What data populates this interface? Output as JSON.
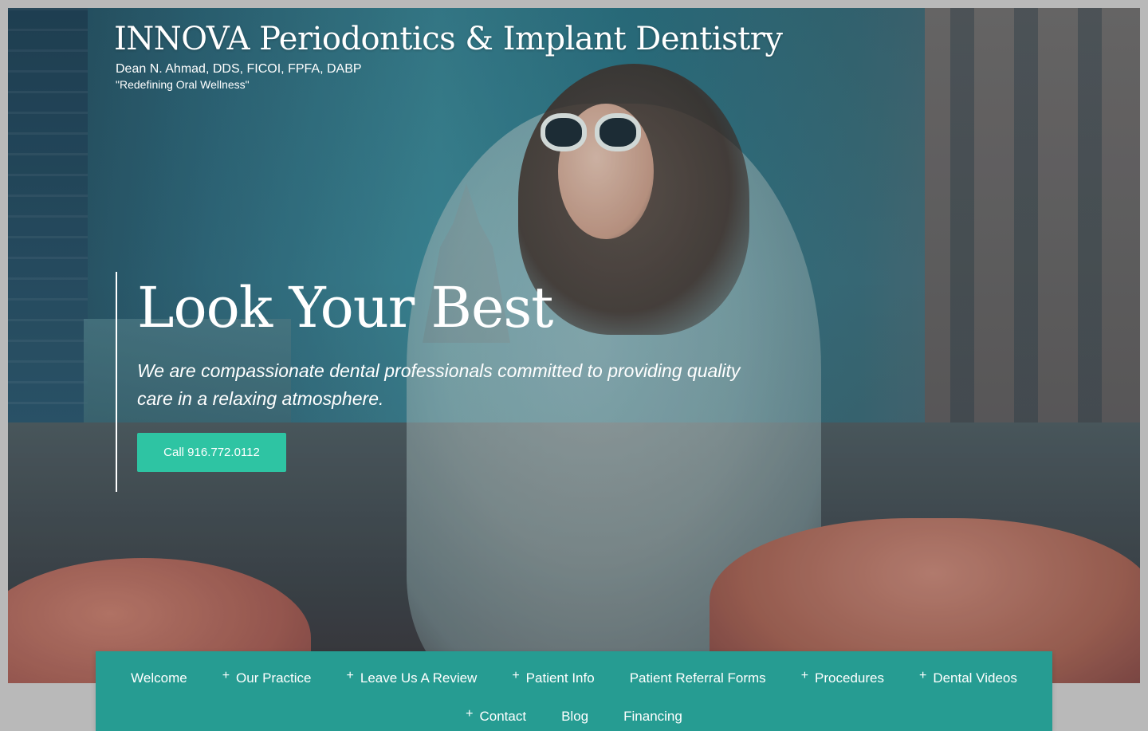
{
  "header": {
    "site_title": "INNOVA Periodontics & Implant Dentistry",
    "doctor": "Dean N. Ahmad, DDS, FICOI, FPFA, DABP",
    "tagline": "\"Redefining Oral Wellness\""
  },
  "hero": {
    "heading": "Look Your Best",
    "subheading": "We are compassionate dental professionals committed to providing quality care in a relaxing atmosphere.",
    "cta_label": "Call 916.772.0112"
  },
  "nav": {
    "items": [
      {
        "label": "Welcome",
        "has_submenu": false
      },
      {
        "label": "Our Practice",
        "has_submenu": true
      },
      {
        "label": "Leave Us A Review",
        "has_submenu": true
      },
      {
        "label": "Patient Info",
        "has_submenu": true
      },
      {
        "label": "Patient Referral Forms",
        "has_submenu": false
      },
      {
        "label": "Procedures",
        "has_submenu": true
      },
      {
        "label": "Dental Videos",
        "has_submenu": true
      },
      {
        "label": "Contact",
        "has_submenu": true
      },
      {
        "label": "Blog",
        "has_submenu": false
      },
      {
        "label": "Financing",
        "has_submenu": false
      }
    ],
    "submenu_glyph": "+"
  },
  "colors": {
    "accent": "#2ec4a3",
    "nav_background": "#269c92",
    "text": "#ffffff"
  }
}
